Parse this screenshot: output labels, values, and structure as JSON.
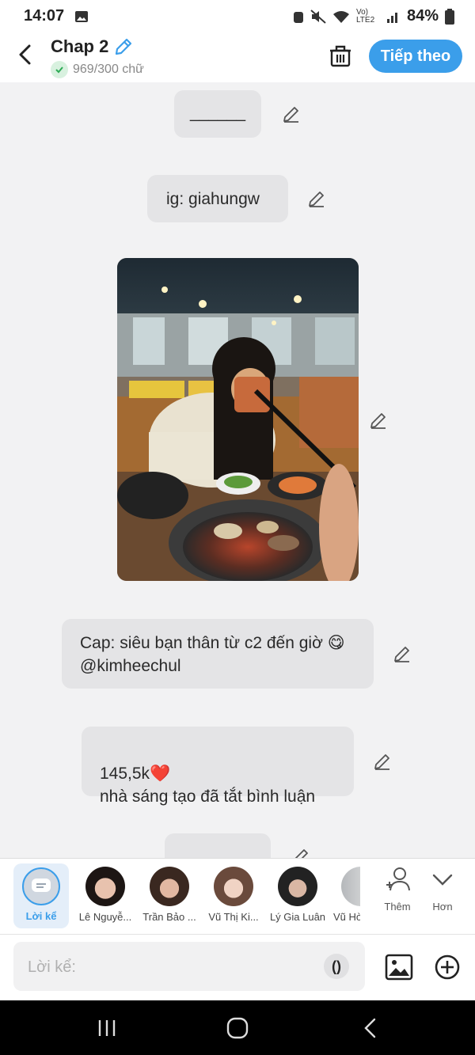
{
  "status_bar": {
    "time": "14:07",
    "network": "Vo) LTE2",
    "battery": "84%"
  },
  "header": {
    "title": "Chap 2",
    "word_count": "969/300 chữ",
    "next_label": "Tiếp theo"
  },
  "messages": [
    {
      "text": "______"
    },
    {
      "text": "ig: giahungw"
    },
    {
      "text": "Cap: siêu bạn thân từ c2 đến giờ 😋 @kimheechul"
    },
    {
      "text": "145,5k❤️\nnhà sáng tạo đã tắt bình luận"
    }
  ],
  "characters": {
    "narrator": "Lời kể",
    "items": [
      {
        "name": "Lê Nguyễ..."
      },
      {
        "name": "Trần Bảo ..."
      },
      {
        "name": "Vũ Thị Ki..."
      },
      {
        "name": "Lý Gia Luân"
      },
      {
        "name": "Vũ Hò"
      }
    ],
    "add_label": "Thêm",
    "more_label": "Hơn"
  },
  "composer": {
    "placeholder": "Lời kể:",
    "paren_label": "()"
  },
  "colors": {
    "accent": "#3b9eea",
    "bubble": "#e4e4e6",
    "background": "#f2f2f3"
  }
}
